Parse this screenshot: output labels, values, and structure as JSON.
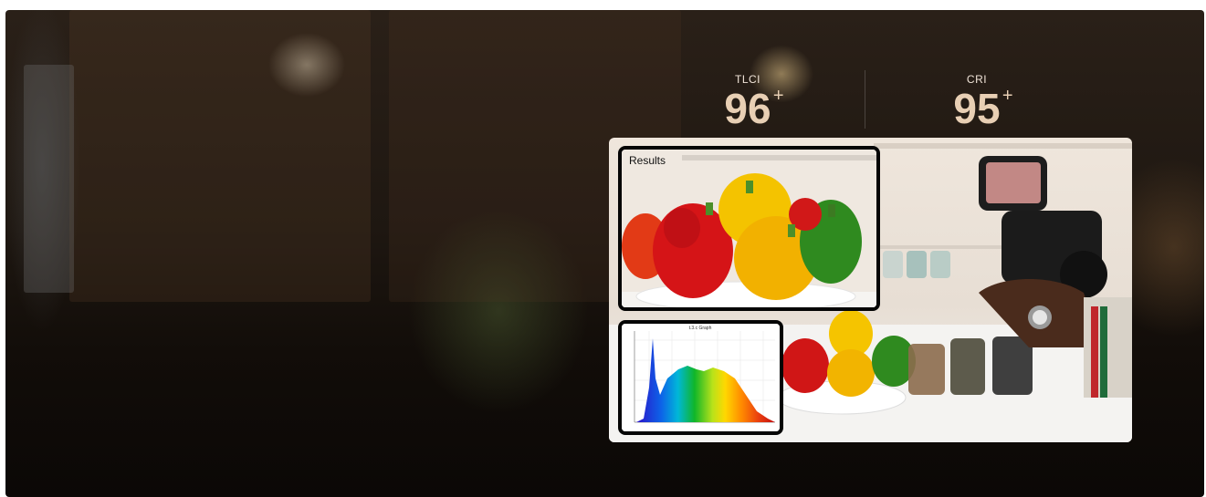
{
  "metrics": {
    "tlci": {
      "label": "TLCI",
      "value": "96",
      "suffix": "+"
    },
    "cri": {
      "label": "CRI",
      "value": "95",
      "suffix": "+"
    }
  },
  "results_inset": {
    "label": "Results"
  },
  "spectrum_inset": {
    "title": "t.3.c Graph"
  },
  "colors": {
    "metric_text": "#e8cfb4",
    "inset_border": "#050505",
    "background": "#1e1711"
  }
}
